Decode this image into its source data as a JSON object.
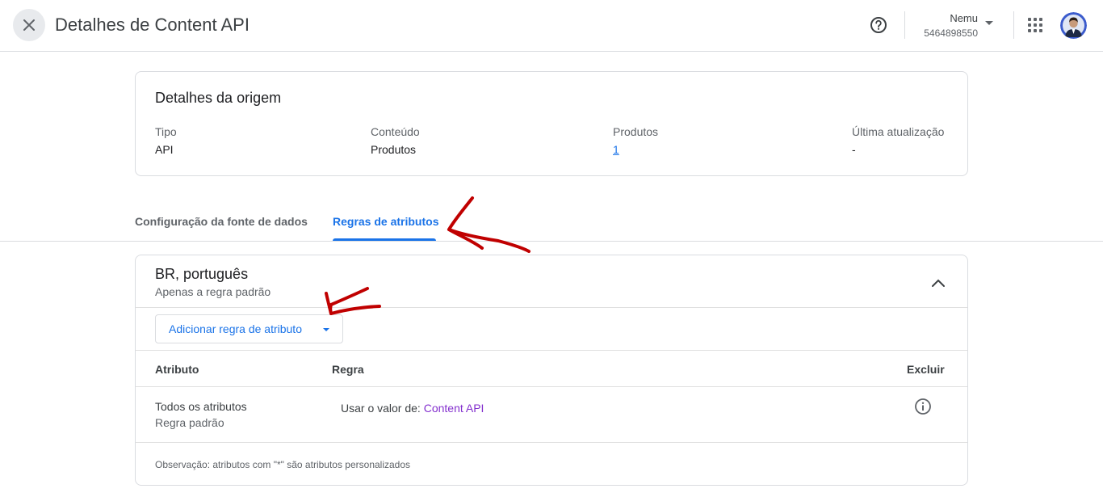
{
  "header": {
    "title": "Detalhes de Content API",
    "account_name": "Nemu",
    "account_id": "5464898550",
    "icons": [
      "close-icon",
      "help-icon",
      "dropdown-caret-icon",
      "apps-grid-icon",
      "avatar"
    ]
  },
  "origin": {
    "title": "Detalhes da origem",
    "fields": [
      {
        "label": "Tipo",
        "value": "API"
      },
      {
        "label": "Conteúdo",
        "value": "Produtos"
      },
      {
        "label": "Produtos",
        "value": "1"
      },
      {
        "label": "Última atualização",
        "value": "-"
      }
    ]
  },
  "tabs": [
    {
      "label": "Configuração da fonte de dados",
      "active": false
    },
    {
      "label": "Regras de atributos",
      "active": true
    }
  ],
  "rules_section": {
    "title": "BR, português",
    "subtitle": "Apenas a regra padrão",
    "add_button": "Adicionar regra de atributo",
    "table": {
      "headers": [
        "Atributo",
        "Regra",
        "Excluir"
      ],
      "rows": [
        {
          "attribute": "Todos os atributos",
          "attribute_sub": "Regra padrão",
          "rule_prefix": "Usar o valor de:",
          "rule_source": "Content API"
        }
      ]
    },
    "footnote": "Observação: atributos com \"*\" são atributos personalizados"
  },
  "colors": {
    "accent": "#1a73e8",
    "rule_source": "#8430ce",
    "annotation_red": "#c00000",
    "border": "#dadce0"
  }
}
